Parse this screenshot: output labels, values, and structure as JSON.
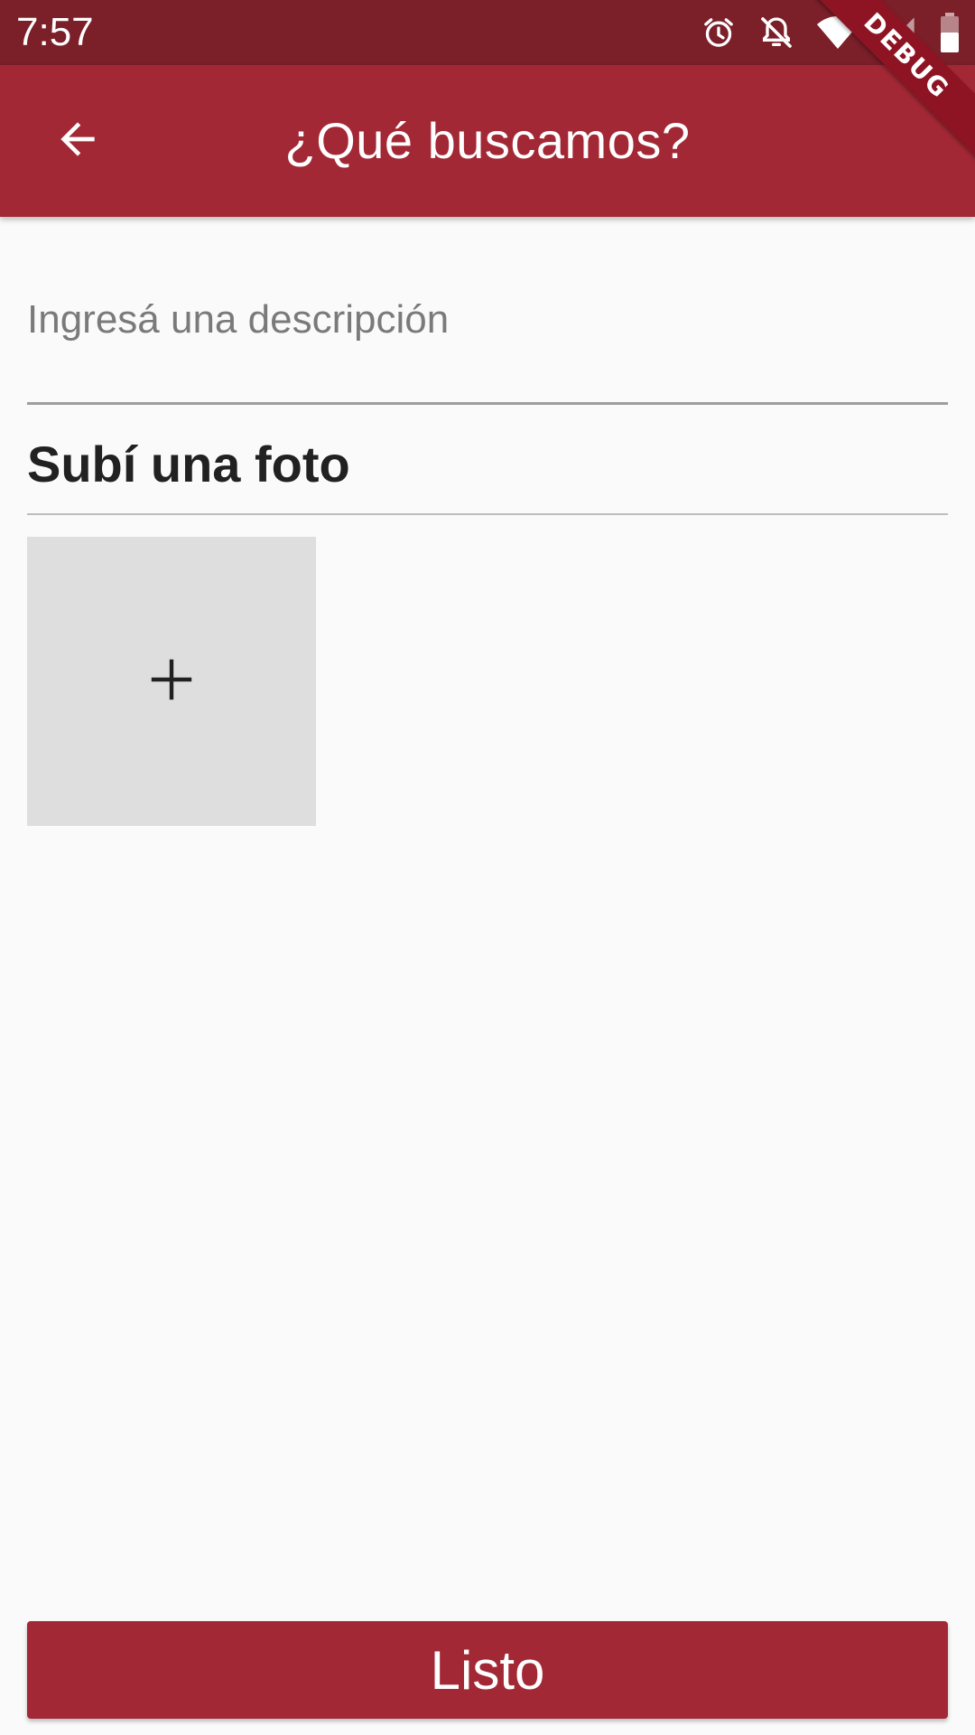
{
  "status_bar": {
    "time": "7:57",
    "icons": [
      "alarm-icon",
      "notifications-off-icon",
      "wifi-icon",
      "signal-icon",
      "battery-icon"
    ],
    "color": "#7B1F29"
  },
  "debug_banner": {
    "label": "DEBUG"
  },
  "app_bar": {
    "title": "¿Qué buscamos?",
    "back_icon": "arrow-back-icon",
    "color": "#A32835"
  },
  "description_field": {
    "placeholder": "Ingresá una descripción",
    "value": ""
  },
  "photo_section": {
    "title": "Subí una foto",
    "add_tile_icon": "add-icon"
  },
  "done_button": {
    "label": "Listo",
    "color": "#A32835"
  }
}
